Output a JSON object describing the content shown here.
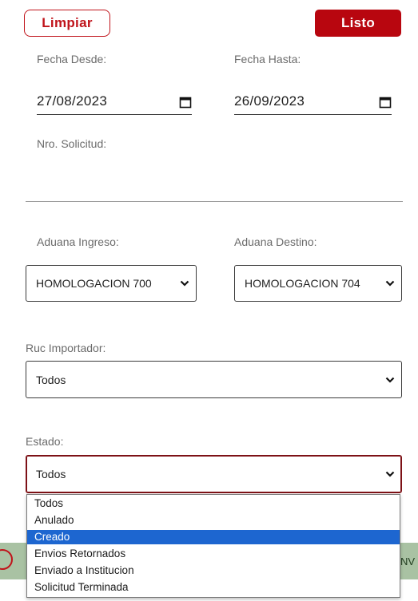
{
  "actions": {
    "clear_label": "Limpiar",
    "done_label": "Listo"
  },
  "filters": {
    "date_from": {
      "label": "Fecha Desde:",
      "value": "27/08/2023"
    },
    "date_to": {
      "label": "Fecha Hasta:",
      "value": "26/09/2023"
    },
    "request_number": {
      "label": "Nro. Solicitud:",
      "value": ""
    },
    "customs_entry": {
      "label": "Aduana Ingreso:",
      "selected": "HOMOLOGACION 700"
    },
    "customs_destination": {
      "label": "Aduana Destino:",
      "selected": "HOMOLOGACION 704"
    },
    "importer_ruc": {
      "label": "Ruc Importador:",
      "selected": "Todos"
    },
    "status": {
      "label": "Estado:",
      "selected": "Todos",
      "highlighted": "Creado",
      "options": [
        "Todos",
        "Anulado",
        "Creado",
        "Envios Retornados",
        "Enviado a Institucion",
        "Solicitud Terminada"
      ]
    }
  },
  "background": {
    "right_text": "NV"
  },
  "colors": {
    "primary_red": "#b8060f",
    "option_highlight": "#1d66d0",
    "background_bar": "#a9c2a3"
  },
  "icons": {
    "calendar": "calendar-icon",
    "chevron": "chevron-down-icon"
  }
}
